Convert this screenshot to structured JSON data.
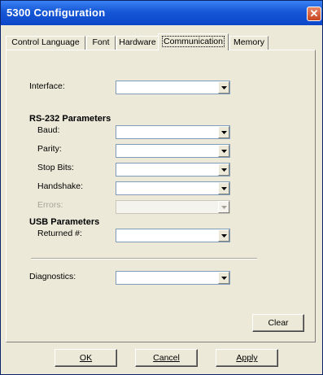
{
  "window": {
    "title": "5300 Configuration",
    "close_glyph": "✕"
  },
  "tabs": [
    {
      "label": "Control Language",
      "active": false
    },
    {
      "label": "Font",
      "active": false
    },
    {
      "label": "Hardware",
      "active": false
    },
    {
      "label": "Communication",
      "active": true
    },
    {
      "label": "Memory",
      "active": false
    }
  ],
  "form": {
    "interface_label": "Interface:",
    "interface_value": "",
    "rs232_heading": "RS-232 Parameters",
    "baud_label": "Baud:",
    "baud_value": "",
    "parity_label": "Parity:",
    "parity_value": "",
    "stopbits_label": "Stop Bits:",
    "stopbits_value": "",
    "handshake_label": "Handshake:",
    "handshake_value": "",
    "errors_label": "Errors:",
    "errors_value": "",
    "usb_heading": "USB Parameters",
    "returned_label": "Returned #:",
    "returned_value": "",
    "diagnostics_label": "Diagnostics:",
    "diagnostics_value": "",
    "clear_label": "Clear"
  },
  "footer": {
    "ok_label": "OK",
    "cancel_label": "Cancel",
    "apply_label": "Apply"
  },
  "icons": {
    "dropdown": "chevron-down-icon",
    "close": "close-icon"
  },
  "colors": {
    "titlebar": "#1657d6",
    "face": "#ece9d8",
    "close": "#c6451e"
  }
}
